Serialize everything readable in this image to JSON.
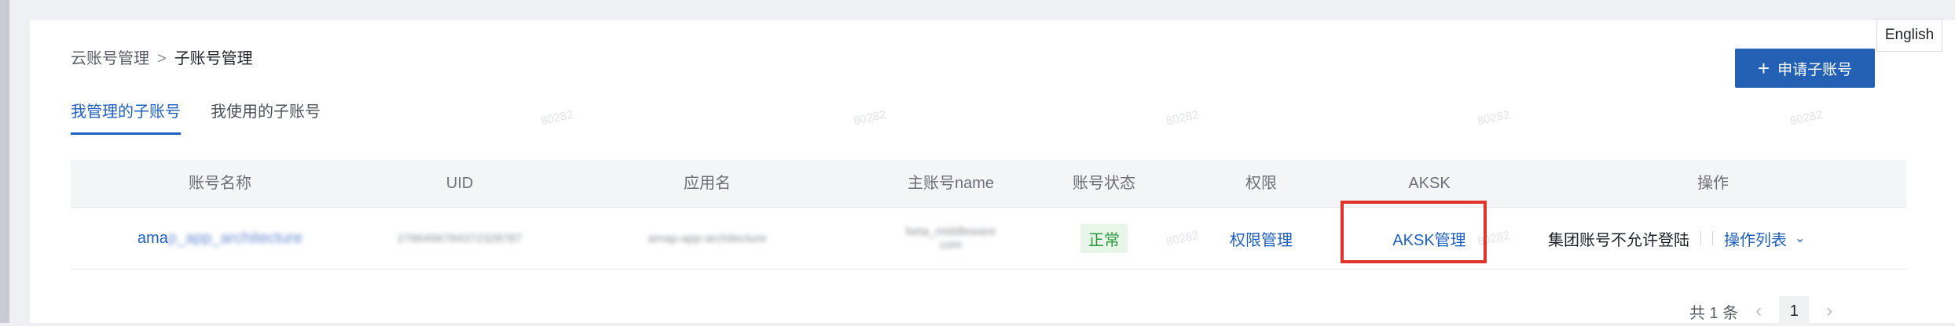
{
  "language_button": "English",
  "breadcrumb": {
    "parent": "云账号管理",
    "separator": ">",
    "current": "子账号管理"
  },
  "tabs": [
    {
      "label": "我管理的子账号",
      "active": true
    },
    {
      "label": "我使用的子账号",
      "active": false
    }
  ],
  "apply_button": {
    "icon": "+",
    "label": "申请子账号"
  },
  "watermark": "80282",
  "table": {
    "headers": [
      "账号名称",
      "UID",
      "应用名",
      "主账号name",
      "账号状态",
      "权限",
      "AKSK",
      "操作"
    ],
    "rows": [
      {
        "name_visible": "ama",
        "name_masked": "p_app_architecture",
        "uid_masked": "2786496784372328787",
        "app_masked": "amap-app-architecture",
        "main_line1_masked": "beta_middleware",
        "main_line2_masked": "com",
        "status": "正常",
        "permission_link": "权限管理",
        "aksk_link": "AKSK管理",
        "ops_text": "集团账号不允许登陆",
        "ops_list": "操作列表"
      }
    ]
  },
  "pagination": {
    "total": "共 1 条",
    "prev": "‹",
    "page": "1",
    "next": "›"
  },
  "colors": {
    "primary": "#2461b4",
    "link": "#1f5fbf",
    "highlight": "#e0332c",
    "status_green": "#2c9a3c"
  }
}
